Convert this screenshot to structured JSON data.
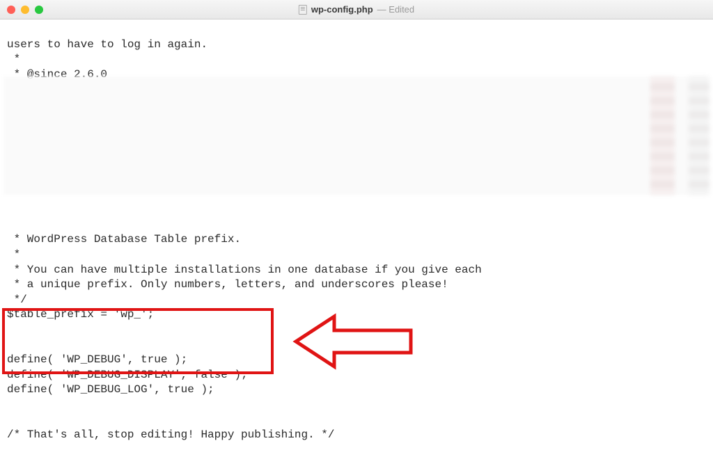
{
  "window": {
    "filename": "wp-config.php",
    "edited_label": "— Edited"
  },
  "code": {
    "line1": "users to have to log in again.",
    "line2": " *",
    "line3": " * @since 2.6.0",
    "line4": " */",
    "line5": " * WordPress Database Table prefix.",
    "line6": " *",
    "line7": " * You can have multiple installations in one database if you give each",
    "line8": " * a unique prefix. Only numbers, letters, and underscores please!",
    "line9": " */",
    "line10": "$table_prefix = 'wp_';",
    "line11": "",
    "line12": "",
    "line13": "define( 'WP_DEBUG', true );",
    "line14": "define( 'WP_DEBUG_DISPLAY', false );",
    "line15": "define( 'WP_DEBUG_LOG', true );",
    "line16": "",
    "line17": "",
    "line18": "/* That's all, stop editing! Happy publishing. */"
  },
  "annotation": {
    "highlight_box": "debug-defines",
    "arrow_direction": "left"
  }
}
